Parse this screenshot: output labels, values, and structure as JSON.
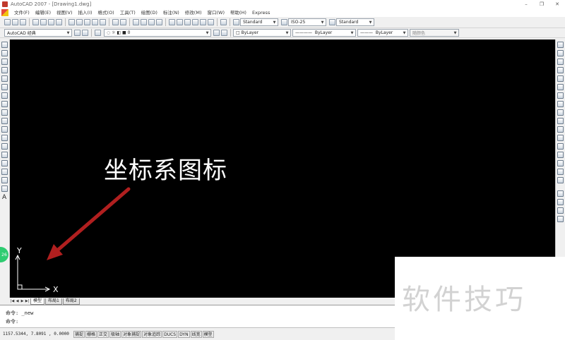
{
  "window": {
    "title": "AutoCAD 2007 - [Drawing1.dwg]",
    "controls": [
      "–",
      "❐",
      "✕"
    ]
  },
  "menu": [
    "文件(F)",
    "编辑(E)",
    "视图(V)",
    "插入(I)",
    "格式(O)",
    "工具(T)",
    "绘图(D)",
    "标注(N)",
    "修改(M)",
    "窗口(W)",
    "帮助(H)",
    "Express"
  ],
  "toolbar1": {
    "text_style": "Standard",
    "dim_style": "ISO-25",
    "table_style": "Standard"
  },
  "toolbar2": {
    "workspace": "AutoCAD 经典",
    "layer": "0",
    "color": "ByLayer",
    "linetype": "ByLayer",
    "lineweight": "ByLayer",
    "plot_style": "随颜色"
  },
  "left_palette": {
    "text_tool": "A"
  },
  "canvas": {
    "annotation": "坐标系图标",
    "ucs_x_label": "X",
    "ucs_y_label": "Y",
    "arrow_color": "#b01f1f",
    "background": "#000000"
  },
  "tabs": {
    "nav": [
      "|◀",
      "◀",
      "▶",
      "▶|"
    ],
    "items": [
      "模型",
      "布局1",
      "布局2"
    ],
    "active": "模型"
  },
  "command": {
    "history": "命令: _new",
    "prompt": "命令:"
  },
  "status": {
    "coordinates": "1157.5344, 7.8091 , 0.0000",
    "buttons": [
      "捕捉",
      "栅格",
      "正交",
      "极轴",
      "对象捕捉",
      "对象追踪",
      "DUCS",
      "DYN",
      "线宽",
      "模型"
    ]
  },
  "watermark": "软件技巧",
  "float_button": "26"
}
